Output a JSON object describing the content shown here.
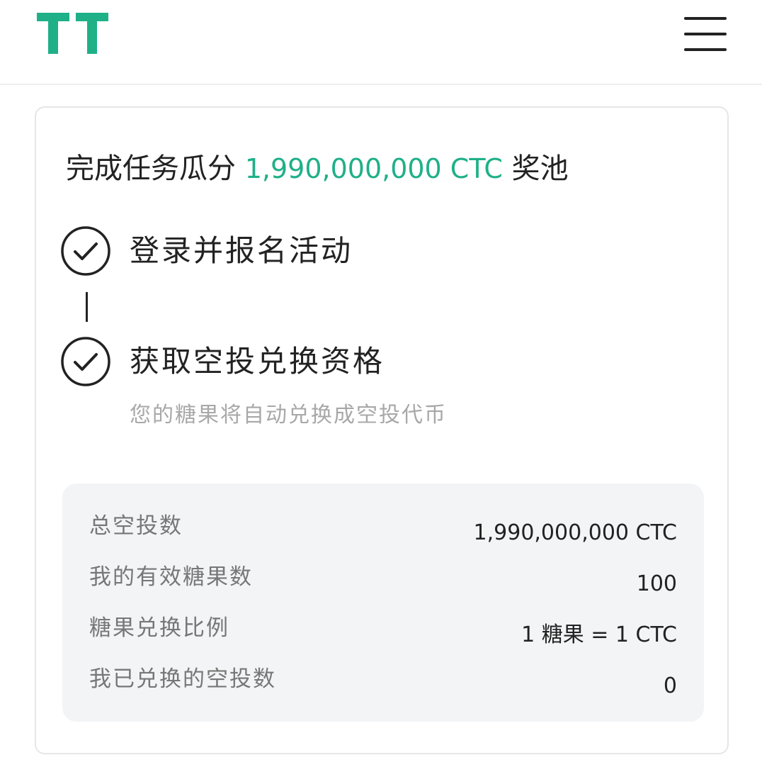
{
  "header": {
    "logo_text": "TT",
    "logo_color": "#1fb088",
    "menu_icon": "hamburger-menu-icon"
  },
  "card": {
    "title_prefix": "完成任务瓜分",
    "title_amount": "1,990,000,000 CTC",
    "title_suffix": "奖池",
    "accent_color": "#1fb088",
    "steps": [
      {
        "label": "登录并报名活动",
        "icon": "check-circle-icon"
      },
      {
        "label": "获取空投兑换资格",
        "sub": "您的糖果将自动兑换成空投代币",
        "icon": "check-circle-icon"
      }
    ],
    "stats": [
      {
        "label": "总空投数",
        "value": "1,990,000,000 CTC"
      },
      {
        "label": "我的有效糖果数",
        "value": "100"
      },
      {
        "label": "糖果兑换比例",
        "value": "1 糖果 = 1 CTC"
      },
      {
        "label": "我已兑换的空投数",
        "value": "0"
      }
    ]
  }
}
